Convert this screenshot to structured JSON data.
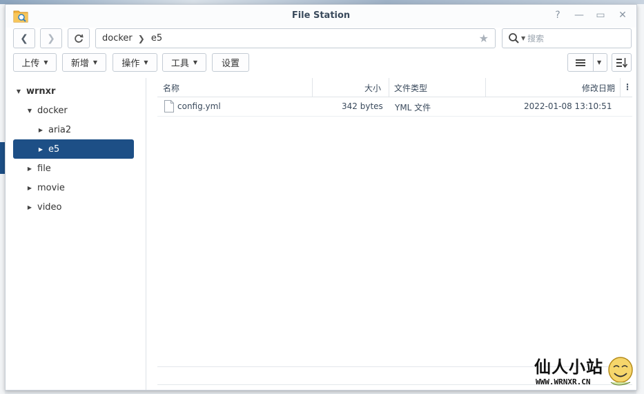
{
  "window": {
    "title": "File Station"
  },
  "titlebar": {
    "help_icon": "?",
    "minimize_icon": "—",
    "maximize_icon": "▭",
    "close_icon": "✕"
  },
  "toolbar": {
    "path": [
      "docker",
      "e5"
    ],
    "search_placeholder": "搜索",
    "buttons": {
      "upload": "上传",
      "create": "新增",
      "action": "操作",
      "tools": "工具",
      "settings": "设置"
    }
  },
  "tree": {
    "root": "wrnxr",
    "items": [
      {
        "label": "docker",
        "level": 1,
        "expanded": true
      },
      {
        "label": "aria2",
        "level": 2,
        "expanded": false
      },
      {
        "label": "e5",
        "level": 2,
        "expanded": false,
        "selected": true
      },
      {
        "label": "file",
        "level": 1,
        "expanded": false
      },
      {
        "label": "movie",
        "level": 1,
        "expanded": false
      },
      {
        "label": "video",
        "level": 1,
        "expanded": false
      }
    ]
  },
  "list": {
    "columns": {
      "name": "名称",
      "size": "大小",
      "type": "文件类型",
      "modified": "修改日期"
    },
    "rows": [
      {
        "name": "config.yml",
        "size": "342 bytes",
        "type": "YML 文件",
        "modified": "2022-01-08 13:10:51"
      }
    ]
  },
  "watermark": {
    "title": "仙人小站",
    "url": "WWW.WRNXR.CN"
  },
  "colors": {
    "selected": "#1d4f86",
    "border": "#c3cbd4"
  }
}
